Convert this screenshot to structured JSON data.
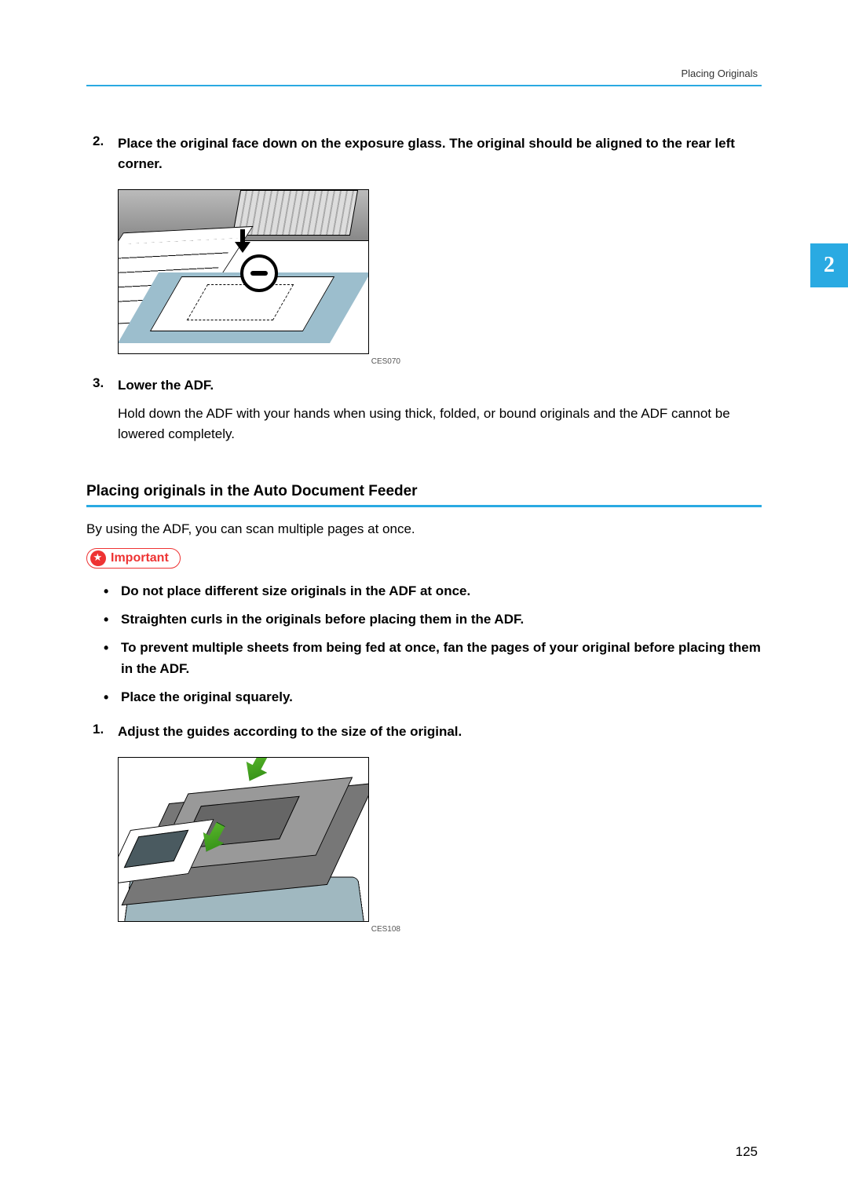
{
  "header": {
    "section": "Placing Originals"
  },
  "chapter_tab": "2",
  "steps_a": [
    {
      "num": "2.",
      "text": "Place the original face down on the exposure glass. The original should be aligned to the rear left corner.",
      "fig_caption": "CES070"
    },
    {
      "num": "3.",
      "text": "Lower the ADF.",
      "body": "Hold down the ADF with your hands when using thick, folded, or bound originals and the ADF cannot be lowered completely."
    }
  ],
  "section": {
    "title": "Placing originals in the Auto Document Feeder",
    "intro": "By using the ADF, you can scan multiple pages at once."
  },
  "important": {
    "label": "Important",
    "bullets": [
      "Do not place different size originals in the ADF at once.",
      "Straighten curls in the originals before placing them in the ADF.",
      "To prevent multiple sheets from being fed at once, fan the pages of your original before placing them in the ADF.",
      "Place the original squarely."
    ]
  },
  "steps_b": [
    {
      "num": "1.",
      "text": "Adjust the guides according to the size of the original.",
      "fig_caption": "CES108"
    }
  ],
  "page_number": "125"
}
